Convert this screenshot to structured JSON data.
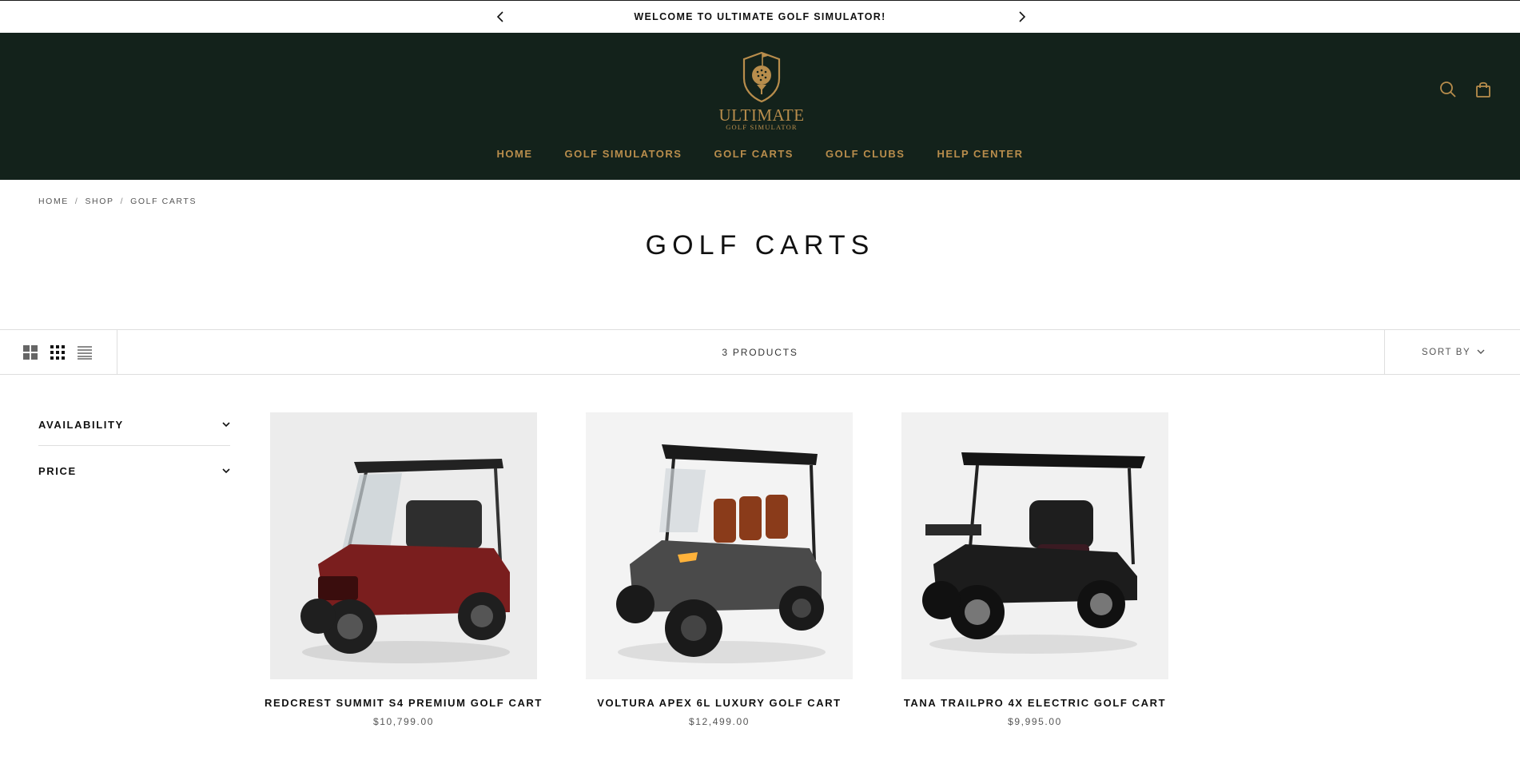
{
  "announcement": {
    "message": "WELCOME TO ULTIMATE GOLF SIMULATOR!",
    "prev_icon": "chevron-left-icon",
    "next_icon": "chevron-right-icon"
  },
  "header": {
    "logo_word": "ULTIMATE",
    "logo_sub": "GOLF SIMULATOR",
    "nav": [
      "HOME",
      "GOLF SIMULATORS",
      "GOLF CARTS",
      "GOLF CLUBS",
      "HELP CENTER"
    ],
    "icons": [
      "search-icon",
      "shopping-bag-icon"
    ],
    "background_color": "#13221b",
    "accent_color": "#b88d4c"
  },
  "breadcrumb": [
    "HOME",
    "SHOP",
    "GOLF CARTS"
  ],
  "page_title": "GOLF CARTS",
  "toolbar": {
    "layout_icons": [
      "grid-2-icon",
      "grid-3-icon",
      "list-icon"
    ],
    "product_count": "3 PRODUCTS",
    "sort_label": "SORT BY"
  },
  "filters": [
    "AVAILABILITY",
    "PRICE"
  ],
  "products": [
    {
      "name": "REDCREST SUMMIT S4 PREMIUM GOLF CART",
      "price": "$10,799.00",
      "body_color": "#7a1e1e"
    },
    {
      "name": "VOLTURA APEX 6L LUXURY GOLF CART",
      "price": "$12,499.00",
      "body_color": "#4a4a4a"
    },
    {
      "name": "TANA TRAILPRO 4X ELECTRIC GOLF CART",
      "price": "$9,995.00",
      "body_color": "#1c1c1c"
    }
  ]
}
